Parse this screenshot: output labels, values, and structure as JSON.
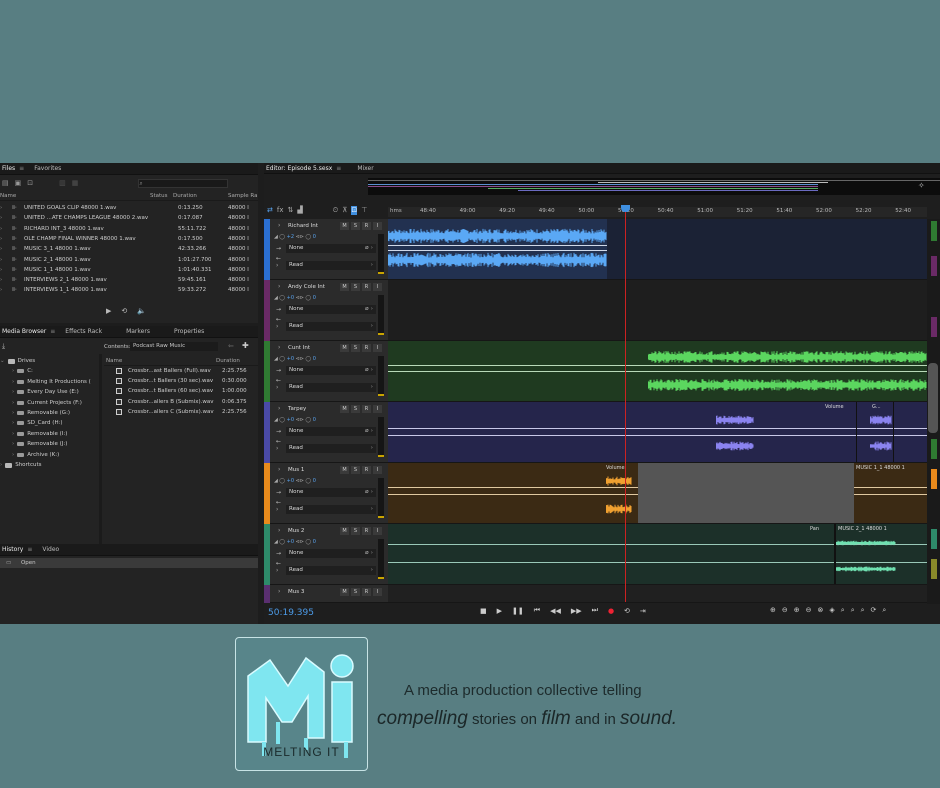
{
  "files_panel": {
    "tabs": [
      "Files",
      "Favorites"
    ],
    "columns": [
      "Name",
      "Status",
      "Duration",
      "Sample Ra"
    ],
    "rows": [
      {
        "name": "UNITED GOALS CLIP 48000 1.wav",
        "duration": "0:13.250",
        "rate": "48000 l"
      },
      {
        "name": "UNITED ...ATE CHAMPS LEAGUE 48000 2.wav",
        "duration": "0:17.087",
        "rate": "48000 l"
      },
      {
        "name": "RICHARD INT_3 48000 1.wav",
        "duration": "55:11.722",
        "rate": "48000 l"
      },
      {
        "name": "OLE CHAMP FINAL WINNER 48000 1.wav",
        "duration": "0:17.500",
        "rate": "48000 l"
      },
      {
        "name": "MUSIC 3_1 48000 1.wav",
        "duration": "42:33.266",
        "rate": "48000 l"
      },
      {
        "name": "MUSIC 2_1 48000 1.wav",
        "duration": "1:01:27.700",
        "rate": "48000 l"
      },
      {
        "name": "MUSIC 1_1 48000 1.wav",
        "duration": "1:01:40.331",
        "rate": "48000 l"
      },
      {
        "name": "INTERVIEWS 2_1 48000 1.wav",
        "duration": "59:45.161",
        "rate": "48000 l"
      },
      {
        "name": "INTERVIEWS 1_1 48000 1.wav",
        "duration": "59:33.272",
        "rate": "48000 l"
      }
    ]
  },
  "media_browser": {
    "tabs": [
      "Media Browser",
      "Effects Rack",
      "Markers",
      "Properties"
    ],
    "contents_label": "Contents:",
    "contents_value": "Podcast Raw Music",
    "tree": [
      "Drives",
      "C:",
      "Melting It Productions (",
      "Every Day Use (E:)",
      "Current Projects (F:)",
      "Removable (G:)",
      "SD_Card (H:)",
      "Removable (I:)",
      "Removable (J:)",
      "Archive (K:)",
      "Shortcuts"
    ],
    "columns": [
      "Name",
      "Duration"
    ],
    "files": [
      {
        "name": "Crossbr...ast Ballers (Full).wav",
        "duration": "2:25.756"
      },
      {
        "name": "Crossbr...t Ballers (30 sec).wav",
        "duration": "0:30.000"
      },
      {
        "name": "Crossbr...t Ballers (60 sec).wav",
        "duration": "1:00.000"
      },
      {
        "name": "Crossbr...allers B (Submix).wav",
        "duration": "0:06.375"
      },
      {
        "name": "Crossbr...allers C (Submix).wav",
        "duration": "2:25.756"
      }
    ]
  },
  "history_panel": {
    "tabs": [
      "History",
      "Video"
    ],
    "items": [
      "Open"
    ]
  },
  "editor": {
    "tabs": [
      "Editor: Episode 5.sesx",
      "Mixer"
    ],
    "ruler": [
      "hms",
      "48:40",
      "49:00",
      "49:20",
      "49:40",
      "50:00",
      "50:20",
      "50:40",
      "51:00",
      "51:20",
      "51:40",
      "52:00",
      "52:20",
      "52:40"
    ],
    "timecode": "50:19.395",
    "tracks": [
      {
        "name": "Richard Int",
        "vol": "+2",
        "pan": "0",
        "input": "None",
        "mode": "Read",
        "color": "#2b6fd1",
        "lane_bg": "#1b2235"
      },
      {
        "name": "Andy Cole Int",
        "vol": "+0",
        "pan": "0",
        "input": "None",
        "mode": "Read",
        "color": "#6a2a66",
        "lane_bg": "#1e1e1e"
      },
      {
        "name": "Cunt Int",
        "vol": "+0",
        "pan": "0",
        "input": "None",
        "mode": "Read",
        "color": "#2f7a32",
        "lane_bg": "#1f3a20"
      },
      {
        "name": "Tarpey",
        "vol": "+0",
        "pan": "0",
        "input": "None",
        "mode": "Read",
        "color": "#4a4aa6",
        "lane_bg": "#25254b"
      },
      {
        "name": "Mus 1",
        "vol": "+0",
        "pan": "0",
        "input": "None",
        "mode": "Read",
        "color": "#e88a1c",
        "lane_bg": "#3b2a14"
      },
      {
        "name": "Mus 2",
        "vol": "+0",
        "pan": "0",
        "input": "None",
        "mode": "Read",
        "color": "#2e8a6a",
        "lane_bg": "#1c3029"
      },
      {
        "name": "Mus 3",
        "color": "#5a2f70",
        "lane_bg": "#202020"
      }
    ],
    "clip_labels": {
      "tarpey_env": "Volume",
      "tarpey_clip": "G...",
      "mus1_env": "Volume",
      "mus1_clip": "MUSIC 1_1 48000 1",
      "mus2_env": "Pan",
      "mus2_clip": "MUSIC 2_1 48000 1"
    }
  },
  "branding": {
    "logo_text": "MELTING IT",
    "tagline_1": "A media production collective telling",
    "tagline_2a": "compelling",
    "tagline_2b": " stories on ",
    "tagline_2c": "film",
    "tagline_2d": " and in ",
    "tagline_2e": "sound."
  },
  "colors": {
    "background": "#587e82",
    "accent_blue": "#4c9be8",
    "logo_cyan": "#7fe6f0"
  }
}
